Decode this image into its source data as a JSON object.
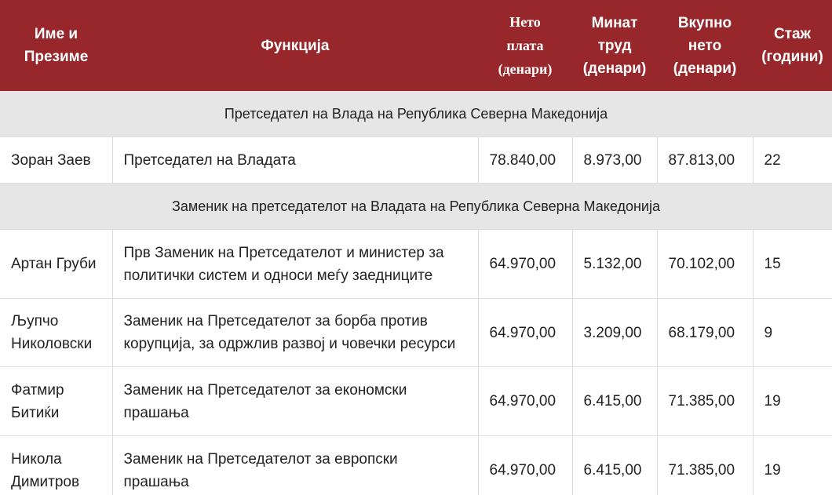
{
  "headers": {
    "name": [
      "Име и",
      "Презиме"
    ],
    "function": "Функција",
    "net_salary": [
      "Нето",
      "плата",
      "(денари)"
    ],
    "past_work": [
      "Минат",
      "труд",
      "(денари)"
    ],
    "total_net": [
      "Вкупно",
      "нето",
      "(денари)"
    ],
    "tenure": [
      "Стаж",
      "(години)"
    ]
  },
  "sections": [
    {
      "title": "Претседател на Влада на Република Северна Македонија",
      "rows": [
        {
          "name": [
            "Зоран Заев"
          ],
          "function": [
            "Претседател на Владата"
          ],
          "net_salary": "78.840,00",
          "past_work": "8.973,00",
          "total_net": "87.813,00",
          "tenure": "22"
        }
      ]
    },
    {
      "title": "Заменик на претседателот на Владата на Република Северна Македонија",
      "rows": [
        {
          "name": [
            "Артан Груби"
          ],
          "function": [
            "Прв Заменик на Претседателот и министер за",
            "политички систем и односи меѓу заедниците"
          ],
          "net_salary": "64.970,00",
          "past_work": "5.132,00",
          "total_net": "70.102,00",
          "tenure": "15"
        },
        {
          "name": [
            "Љупчо",
            "Николовски"
          ],
          "function": [
            "Заменик на Претседателот за борба против",
            "корупција, за одржлив развој и човечки ресурси"
          ],
          "net_salary": "64.970,00",
          "past_work": "3.209,00",
          "total_net": "68.179,00",
          "tenure": "9"
        },
        {
          "name": [
            "Фатмир",
            "Битиќи"
          ],
          "function": [
            "Заменик на Претседателот за економски",
            "прашања"
          ],
          "net_salary": "64.970,00",
          "past_work": "6.415,00",
          "total_net": "71.385,00",
          "tenure": "19"
        },
        {
          "name": [
            "Никола",
            "Димитров"
          ],
          "function": [
            "Заменик на Претседателот за европски",
            "прашања"
          ],
          "net_salary": "64.970,00",
          "past_work": "6.415,00",
          "total_net": "71.385,00",
          "tenure": "19"
        }
      ]
    }
  ]
}
